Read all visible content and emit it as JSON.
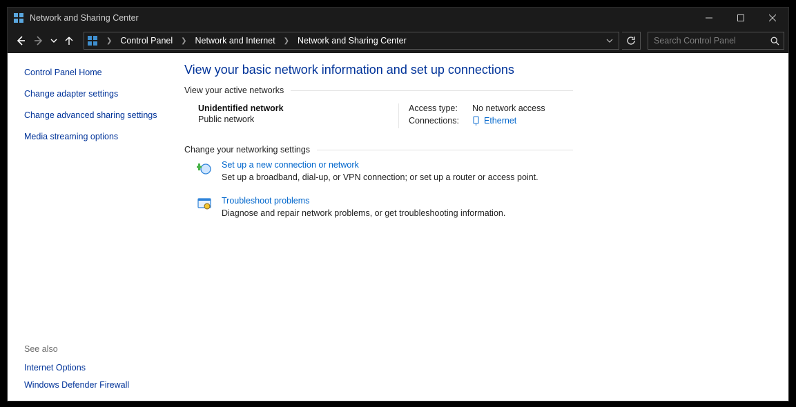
{
  "window": {
    "title": "Network and Sharing Center"
  },
  "breadcrumb": {
    "items": [
      "Control Panel",
      "Network and Internet",
      "Network and Sharing Center"
    ]
  },
  "search": {
    "placeholder": "Search Control Panel"
  },
  "sidebar": {
    "home": "Control Panel Home",
    "links": [
      "Change adapter settings",
      "Change advanced sharing settings",
      "Media streaming options"
    ],
    "see_also_label": "See also",
    "see_also": [
      "Internet Options",
      "Windows Defender Firewall"
    ]
  },
  "main": {
    "title": "View your basic network information and set up connections",
    "active_label": "View your active networks",
    "network": {
      "name": "Unidentified network",
      "kind": "Public network",
      "access_label": "Access type:",
      "access_value": "No network access",
      "conn_label": "Connections:",
      "conn_value": "Ethernet"
    },
    "change_label": "Change your networking settings",
    "settings": [
      {
        "title": "Set up a new connection or network",
        "desc": "Set up a broadband, dial-up, or VPN connection; or set up a router or access point."
      },
      {
        "title": "Troubleshoot problems",
        "desc": "Diagnose and repair network problems, or get troubleshooting information."
      }
    ]
  }
}
